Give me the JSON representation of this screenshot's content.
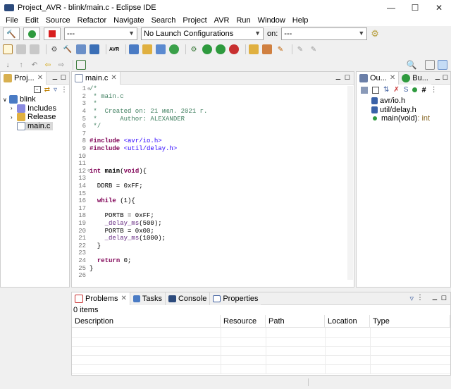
{
  "titlebar": {
    "title": "Project_AVR - blink/main.c - Eclipse IDE",
    "minimize": "—",
    "maximize": "☐",
    "close": "✕"
  },
  "menu": [
    "File",
    "Edit",
    "Source",
    "Refactor",
    "Navigate",
    "Search",
    "Project",
    "AVR",
    "Run",
    "Window",
    "Help"
  ],
  "launch": {
    "mode_value": "---",
    "config_value": "No Launch Configurations",
    "on_label": "on:",
    "target_value": "---"
  },
  "project_explorer": {
    "tab_label": "Proj...",
    "tree": [
      {
        "label": "blink"
      },
      {
        "label": "Includes"
      },
      {
        "label": "Release"
      },
      {
        "label": "main.c"
      }
    ]
  },
  "editor": {
    "tab_label": "main.c",
    "lines": [
      {
        "n": "1",
        "t": "/*"
      },
      {
        "n": "2",
        "t": " * main.c"
      },
      {
        "n": "3",
        "t": " *"
      },
      {
        "n": "4",
        "t": " *  Created on: 21 июл. 2021 г."
      },
      {
        "n": "5",
        "t": " *      Author: ALEXANDER"
      },
      {
        "n": "6",
        "t": " */"
      },
      {
        "n": "7",
        "t": ""
      },
      {
        "n": "8",
        "t": "#include <avr/io.h>"
      },
      {
        "n": "9",
        "t": "#include <util/delay.h>"
      },
      {
        "n": "10",
        "t": ""
      },
      {
        "n": "11",
        "t": ""
      },
      {
        "n": "12",
        "t": "int main(void){"
      },
      {
        "n": "13",
        "t": ""
      },
      {
        "n": "14",
        "t": "  DDRB = 0xFF;"
      },
      {
        "n": "15",
        "t": ""
      },
      {
        "n": "16",
        "t": "  while (1){"
      },
      {
        "n": "17",
        "t": ""
      },
      {
        "n": "18",
        "t": "    PORTB = 0xFF;"
      },
      {
        "n": "19",
        "t": "    _delay_ms(500);"
      },
      {
        "n": "20",
        "t": "    PORTB = 0x00;"
      },
      {
        "n": "21",
        "t": "    _delay_ms(1000);"
      },
      {
        "n": "22",
        "t": "  }"
      },
      {
        "n": "23",
        "t": ""
      },
      {
        "n": "24",
        "t": "  return 0;"
      },
      {
        "n": "25",
        "t": "}"
      },
      {
        "n": "26",
        "t": ""
      }
    ]
  },
  "outline": {
    "tab_outline": "Ou...",
    "tab_build": "Bu...",
    "items": [
      {
        "label": "avr/io.h",
        "suffix": ""
      },
      {
        "label": "util/delay.h",
        "suffix": ""
      },
      {
        "label": "main(void)",
        "suffix": " : int"
      }
    ]
  },
  "bottom": {
    "tabs": [
      "Problems",
      "Tasks",
      "Console",
      "Properties"
    ],
    "count": "0 items",
    "columns": [
      "Description",
      "Resource",
      "Path",
      "Location",
      "Type"
    ]
  },
  "colors": {
    "keyword": "#7f0055",
    "comment": "#3f7f5f",
    "string": "#2a00ff"
  }
}
